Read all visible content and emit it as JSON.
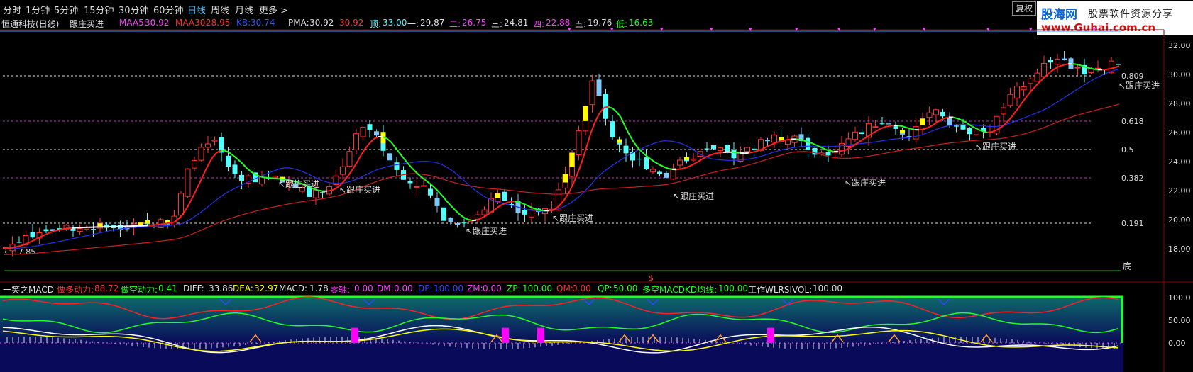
{
  "toolbar": {
    "items": [
      "分时",
      "1分钟",
      "5分钟",
      "15分钟",
      "30分钟",
      "60分钟",
      "日线",
      "周线",
      "月线",
      "更多 >"
    ],
    "active": "日线",
    "fuquan": "复权"
  },
  "logo": {
    "line1": "股海网",
    "line2": "股票软件资源分享",
    "line3": "www.Guhai.com.cn"
  },
  "info": {
    "stock": "恒通科技(日线)",
    "indicator": "跟庄买进",
    "maa5_label": "MAA5:",
    "maa5": "30.92",
    "maa30_label": "MAA30:",
    "maa30": "28.95",
    "kb_label": "KB:",
    "kb": "30.74",
    "pma_label": "PMA:",
    "pma": "30.92",
    "pma2": "30.92",
    "ding_label": "顶:",
    "ding": "33.00",
    "yi_label": "一:",
    "yi": "29.87",
    "er_label": "二:",
    "er": "26.75",
    "san_label": "三:",
    "san": "24.81",
    "si_label": "四:",
    "si": "22.88",
    "wu_label": "五:",
    "wu": "19.76",
    "di_label": "低:",
    "di": "16.63"
  },
  "price_axis": [
    "32.00",
    "30.00",
    "28.00",
    "26.00",
    "24.00",
    "22.00",
    "20.00",
    "18.00"
  ],
  "fib_levels": [
    {
      "label": "0.809",
      "price": 29.87
    },
    {
      "label": "0.618",
      "price": 26.75
    },
    {
      "label": "0.5",
      "price": 24.81
    },
    {
      "label": "0.382",
      "price": 22.88
    },
    {
      "label": "0.191",
      "price": 19.76
    }
  ],
  "bottom_label": "底",
  "low_mark": "17.85",
  "signal_label": "跟庄买进",
  "signal_marker": "$",
  "macd": {
    "title": "一笑之MACD",
    "dd_label": "做多动力:",
    "dd": "88.72",
    "dk_label": "做空动力:",
    "dk": "0.41",
    "diff_label": "DIFF:",
    "diff": "33.86",
    "dea_label": "DEA:",
    "dea": "32.97",
    "macd_label": "MACD:",
    "macd": "1.78",
    "zero_label": "零轴:",
    "zero": "0.00",
    "dm_label": "DM:",
    "dm": "0.00",
    "dp_label": "DP:",
    "dp": "100.00",
    "zm_label": "ZM:",
    "zm": "0.00",
    "zp_label": "ZP:",
    "zp": "100.00",
    "qm_label": "QM:",
    "qm": "0.00",
    "qp_label": "QP:",
    "qp": "50.00",
    "dkj_label": "多空MACDKD均线:",
    "dkj": "100.00",
    "work_label": "工作WLRSIVOL:",
    "work": "100.00"
  },
  "macd_axis": [
    "100.0",
    "50.00",
    "0.00"
  ],
  "colors": {
    "up": "#ff3333",
    "down": "#54ffff",
    "lightblue": "#7ec8f8",
    "yellow": "#ffff00",
    "red_ma": "#ff2020",
    "blue_ma": "#3344ff",
    "green": "#22ff22",
    "grid": "#b040b0",
    "magenta": "#ff00ff"
  }
}
